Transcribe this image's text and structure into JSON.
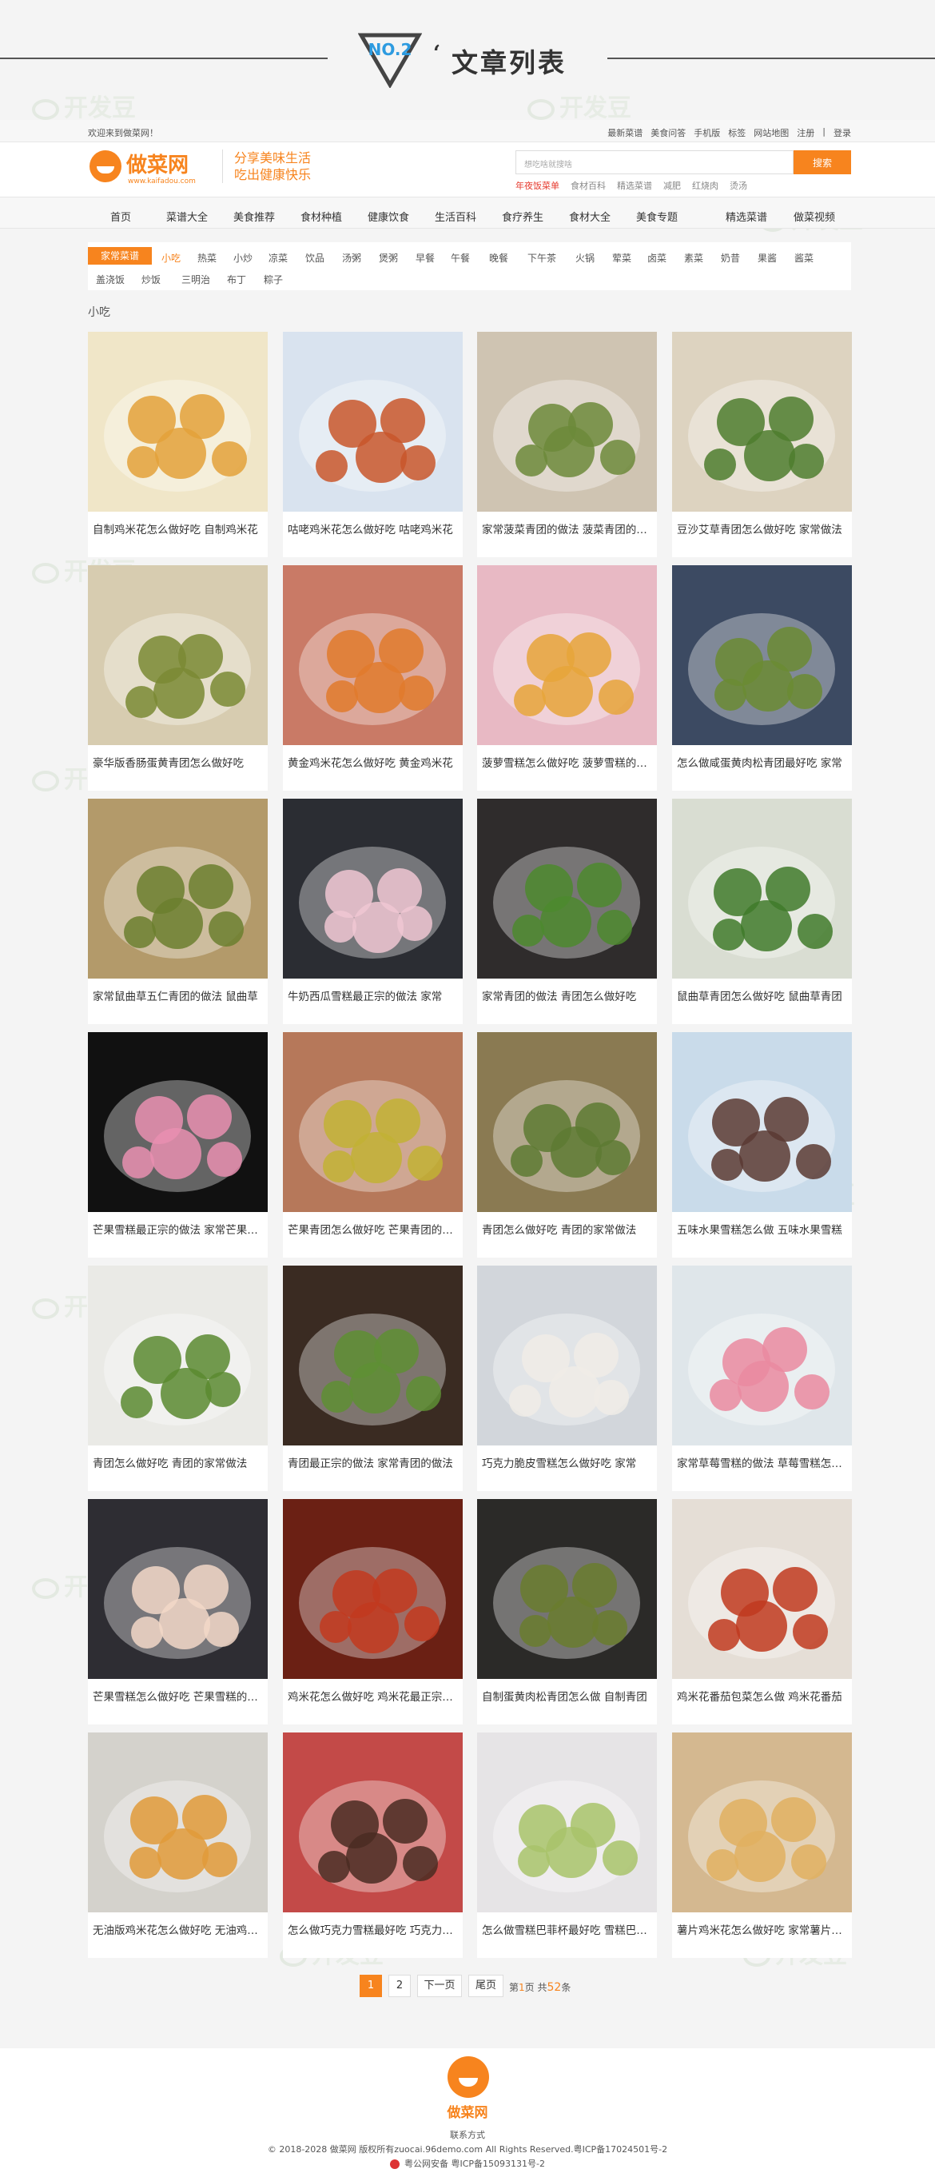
{
  "header": {
    "badge": "NO.2",
    "mark": "‘",
    "title": "文章列表"
  },
  "watermark": "开发豆",
  "topbar": {
    "welcome": "欢迎来到做菜网！",
    "links": [
      "最新菜谱",
      "美食问答",
      "手机版",
      "标签",
      "网站地图",
      "注册",
      "|",
      "登录"
    ]
  },
  "brand": {
    "name": "做菜网",
    "url": "www.kaifadou.com",
    "slogan1": "分享美味生活",
    "slogan2": "吃出健康快乐",
    "search_placeholder": "想吃啥就搜啥",
    "search_button": "搜索",
    "hot": [
      "年夜饭菜单",
      "食材百科",
      "精选菜谱",
      "减肥",
      "红烧肉",
      "烫汤"
    ]
  },
  "nav": [
    "首页",
    "菜谱大全",
    "美食推荐",
    "食材种植",
    "健康饮食",
    "生活百科",
    "食疗养生",
    "食材大全",
    "美食专题",
    "精选菜谱",
    "做菜视频"
  ],
  "cats": {
    "label": "家常菜谱",
    "row1": [
      "小吃",
      "热菜",
      "小炒",
      "凉菜",
      "饮品",
      "汤粥",
      "煲粥",
      "早餐",
      "午餐",
      "晚餐",
      "下午茶",
      "火锅",
      "荤菜",
      "卤菜",
      "素菜",
      "奶昔",
      "果酱",
      "酱菜"
    ],
    "row2": [
      "盖浇饭",
      "炒饭",
      "三明治",
      "布丁",
      "粽子"
    ]
  },
  "section": "小吃",
  "items": [
    {
      "title": "自制鸡米花怎么做好吃 自制鸡米花",
      "bg": "#f0e6c8",
      "food": "#e3a13a",
      "icon": "fried-chicken-icon"
    },
    {
      "title": "咕咾鸡米花怎么做好吃 咕咾鸡米花",
      "bg": "#d9e3ef",
      "food": "#c8562a",
      "icon": "sweet-sour-chicken-icon"
    },
    {
      "title": "家常菠菜青团的做法 菠菜青团的做法",
      "bg": "#cfc4b2",
      "food": "#6c8a3a",
      "icon": "green-dumpling-icon"
    },
    {
      "title": "豆沙艾草青团怎么做好吃 家常做法",
      "bg": "#ddd3c0",
      "food": "#4e7d2e",
      "icon": "green-dumpling-icon"
    },
    {
      "title": "豪华版香肠蛋黄青团怎么做好吃",
      "bg": "#d7ccb0",
      "food": "#7a8a34",
      "icon": "green-dumpling-icon"
    },
    {
      "title": "黄金鸡米花怎么做好吃 黄金鸡米花",
      "bg": "#c97a66",
      "food": "#e07a2c",
      "icon": "fried-chicken-icon"
    },
    {
      "title": "菠萝雪糕怎么做好吃 菠萝雪糕的做法",
      "bg": "#e8b9c4",
      "food": "#e6a43a",
      "icon": "pineapple-icon"
    },
    {
      "title": "怎么做咸蛋黄肉松青团最好吃 家常",
      "bg": "#3c4a62",
      "food": "#6b8b33",
      "icon": "green-dumpling-icon"
    },
    {
      "title": "家常鼠曲草五仁青团的做法 鼠曲草",
      "bg": "#b39a6a",
      "food": "#6b7f2e",
      "icon": "green-dumpling-icon"
    },
    {
      "title": "牛奶西瓜雪糕最正宗的做法 家常",
      "bg": "#2b2d33",
      "food": "#f0c7d2",
      "icon": "popsicle-icon"
    },
    {
      "title": "家常青团的做法 青团怎么做好吃",
      "bg": "#2f2c2c",
      "food": "#4c8a2e",
      "icon": "green-dumpling-icon"
    },
    {
      "title": "鼠曲草青团怎么做好吃 鼠曲草青团",
      "bg": "#d9ddd2",
      "food": "#3f7a2a",
      "icon": "green-dumpling-icon"
    },
    {
      "title": "芒果雪糕最正宗的做法 家常芒果雪糕",
      "bg": "#111111",
      "food": "#e98fb0",
      "icon": "lollipop-icon"
    },
    {
      "title": "芒果青团怎么做好吃 芒果青团的做法",
      "bg": "#b6785a",
      "food": "#c2b234",
      "icon": "green-dumpling-icon"
    },
    {
      "title": "青团怎么做好吃 青团的家常做法",
      "bg": "#8a7a52",
      "food": "#5d7a33",
      "icon": "green-dumpling-icon"
    },
    {
      "title": "五味水果雪糕怎么做 五味水果雪糕",
      "bg": "#c9dbea",
      "food": "#5a3a32",
      "icon": "popsicle-icon"
    },
    {
      "title": "青团怎么做好吃 青团的家常做法",
      "bg": "#eaeae6",
      "food": "#5a8a30",
      "icon": "green-dumpling-icon"
    },
    {
      "title": "青团最正宗的做法 家常青团的做法",
      "bg": "#3a2b22",
      "food": "#5e8f34",
      "icon": "green-dumpling-icon"
    },
    {
      "title": "巧克力脆皮雪糕怎么做好吃 家常",
      "bg": "#d2d6db",
      "food": "#f0ece6",
      "icon": "ice-cream-icon"
    },
    {
      "title": "家常草莓雪糕的做法 草莓雪糕怎么做",
      "bg": "#dfe6ea",
      "food": "#ea8aa0",
      "icon": "popsicle-icon"
    },
    {
      "title": "芒果雪糕怎么做好吃 芒果雪糕的做法",
      "bg": "#2e2d33",
      "food": "#f2d8c8",
      "icon": "popsicle-icon"
    },
    {
      "title": "鸡米花怎么做好吃 鸡米花最正宗的做法",
      "bg": "#6b2014",
      "food": "#c23a1e",
      "icon": "fried-chicken-icon"
    },
    {
      "title": "自制蛋黄肉松青团怎么做 自制青团",
      "bg": "#2b2a28",
      "food": "#6a7c2e",
      "icon": "green-dumpling-icon"
    },
    {
      "title": "鸡米花番茄包菜怎么做 鸡米花番茄",
      "bg": "#e5ded6",
      "food": "#c0391f",
      "icon": "fried-chicken-icon"
    },
    {
      "title": "无油版鸡米花怎么做好吃 无油鸡米花",
      "bg": "#d4d2cc",
      "food": "#e09a3a",
      "icon": "fried-chicken-icon"
    },
    {
      "title": "怎么做巧克力雪糕最好吃 巧克力雪糕",
      "bg": "#c34a48",
      "food": "#4a2b22",
      "icon": "chocolate-ice-cream-icon"
    },
    {
      "title": "怎么做雪糕巴菲杯最好吃 雪糕巴菲杯",
      "bg": "#e6e4e6",
      "food": "#a8c36a",
      "icon": "parfait-icon"
    },
    {
      "title": "薯片鸡米花怎么做好吃 家常薯片鸡米花",
      "bg": "#d4b890",
      "food": "#e0b060",
      "icon": "fried-chicken-icon"
    }
  ],
  "pagination": {
    "current": "1",
    "page2": "2",
    "next": "下一页",
    "last": "尾页",
    "info_pre": "第",
    "info_page": "1",
    "info_mid": "页 共",
    "info_total": "52",
    "info_suf": "条"
  },
  "footer": {
    "logo": "做菜网",
    "contact": "联系方式",
    "copyright": "© 2018-2028 做菜网 版权所有zuocai.96demo.com All Rights Reserved.粤ICP备17024501号-2",
    "police": "粤公网安备 粤ICP备15093131号-2"
  }
}
